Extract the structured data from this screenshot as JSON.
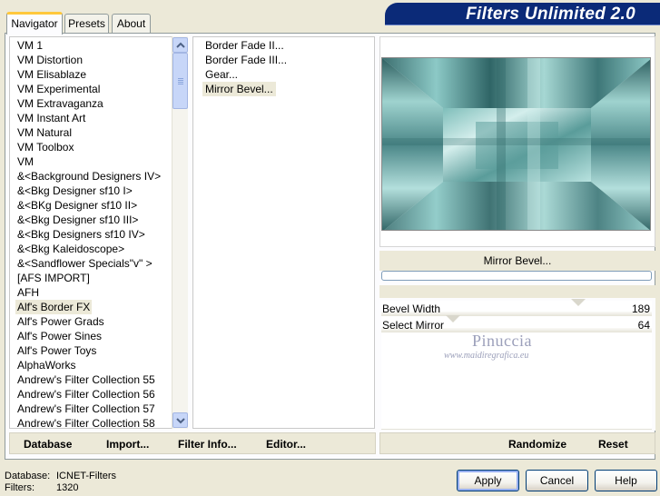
{
  "tabs": [
    {
      "label": "Navigator",
      "active": true
    },
    {
      "label": "Presets",
      "active": false
    },
    {
      "label": "About",
      "active": false
    }
  ],
  "title": "Filters Unlimited 2.0",
  "categories": [
    "VM 1",
    "VM Distortion",
    "VM Elisablaze",
    "VM Experimental",
    "VM Extravaganza",
    "VM Instant Art",
    "VM Natural",
    "VM Toolbox",
    "VM",
    "&<Background Designers IV>",
    "&<Bkg Designer sf10 I>",
    "&<BKg Designer sf10 II>",
    "&<Bkg Designer sf10 III>",
    "&<Bkg Designers sf10 IV>",
    "&<Bkg Kaleidoscope>",
    "&<Sandflower Specials\"v\" >",
    "[AFS IMPORT]",
    "AFH",
    "Alf's Border FX",
    "Alf's Power Grads",
    "Alf's Power Sines",
    "Alf's Power Toys",
    "AlphaWorks",
    "Andrew's Filter Collection 55",
    "Andrew's Filter Collection 56",
    "Andrew's Filter Collection 57",
    "Andrew's Filter Collection 58"
  ],
  "selected_category": "Alf's Border FX",
  "filters": [
    "Border Fade II...",
    "Border Fade III...",
    "Gear...",
    "Mirror Bevel..."
  ],
  "selected_filter": "Mirror Bevel...",
  "preview": {
    "filter_name": "Mirror Bevel...",
    "progress": 0
  },
  "params": [
    {
      "label": "Bevel Width",
      "value": "189",
      "level": 0.74
    },
    {
      "label": "Select Mirror",
      "value": "64",
      "level": 0.25
    }
  ],
  "watermark": {
    "name": "Pinuccia",
    "url": "www.maidiregrafica.eu"
  },
  "toolbar": {
    "database": "Database",
    "import": "Import...",
    "filter_info": "Filter Info...",
    "editor": "Editor..."
  },
  "right_toolbar": {
    "randomize": "Randomize",
    "reset": "Reset"
  },
  "status": {
    "database_label": "Database:",
    "database_value": "ICNET-Filters",
    "filters_label": "Filters:",
    "filters_value": "1320"
  },
  "buttons": {
    "apply": "Apply",
    "cancel": "Cancel",
    "help": "Help"
  },
  "colors": {
    "accent": "#0b2a78",
    "tab_highlight": "#ffc83c",
    "preview_teal": "#6ab3b0"
  },
  "icons": {
    "scroll_up": "chevron-up-icon",
    "scroll_down": "chevron-down-icon"
  }
}
